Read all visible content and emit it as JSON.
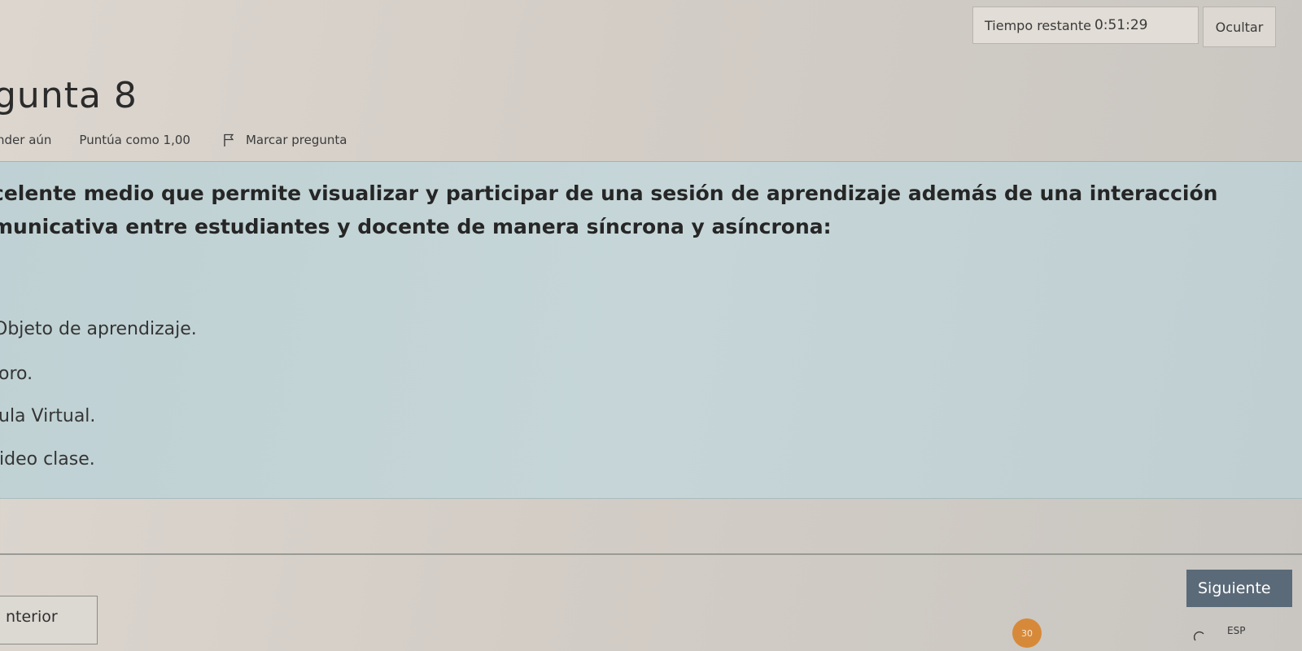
{
  "timer": {
    "label": "Tiempo restante",
    "value": "0:51:29"
  },
  "hide_button": {
    "label": "Ocultar"
  },
  "question": {
    "title": "gunta 8",
    "status": "nder aún",
    "score": "Puntúa como 1,00",
    "flag_label": "Marcar pregunta",
    "text_line1": "celente medio que permite visualizar y participar de una sesión de aprendizaje además de una interacción",
    "text_line2": "municativa entre estudiantes y docente de manera síncrona y asíncrona:",
    "options": [
      "Objeto de aprendizaje.",
      "oro.",
      "ula Virtual.",
      "ideo clase."
    ]
  },
  "navigation": {
    "next_label": "Siguiente",
    "prev_label": "nterior"
  },
  "taskbar": {
    "badge": "30",
    "language": "ESP"
  },
  "colors": {
    "panel": "#c2d3d6",
    "next_button": "#5b6a78",
    "badge": "#d7893a"
  },
  "icons": {
    "flag": "flag-icon",
    "taskbar": "refresh-icon"
  }
}
